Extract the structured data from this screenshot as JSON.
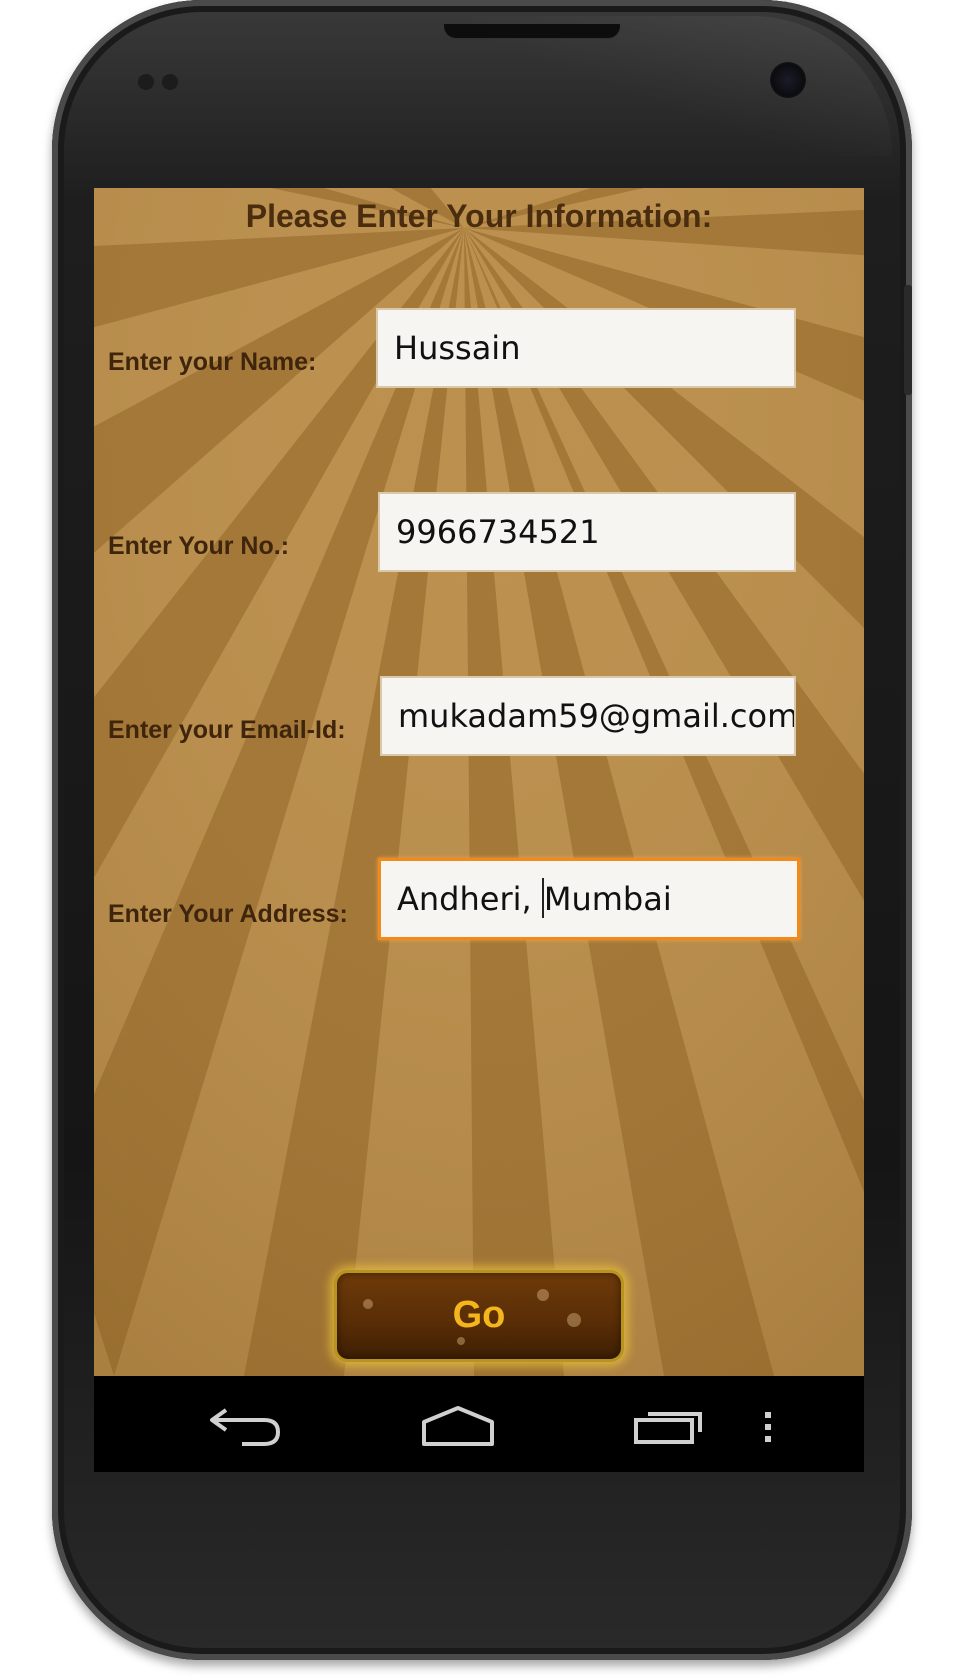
{
  "form": {
    "title": "Please Enter Your Information:",
    "fields": [
      {
        "label": "Enter your Name:",
        "value": "Hussain"
      },
      {
        "label": "Enter Your No.:",
        "value": "9966734521"
      },
      {
        "label": "Enter your Email-Id:",
        "value": "mukadam59@gmail.com"
      },
      {
        "label": "Enter Your Address:",
        "value_before_cursor": "Andheri, ",
        "value_after_cursor": "Mumbai"
      }
    ],
    "go_label": "Go"
  },
  "navbar": {
    "icons": [
      "back-icon",
      "home-icon",
      "recent-apps-icon",
      "overflow-menu-icon"
    ]
  },
  "colors": {
    "background": "#b98c4a",
    "text_dark_brown": "#3f250b",
    "focus_orange": "#f08a1c",
    "button_brown": "#5a2e06",
    "button_text": "#f5b51d"
  }
}
